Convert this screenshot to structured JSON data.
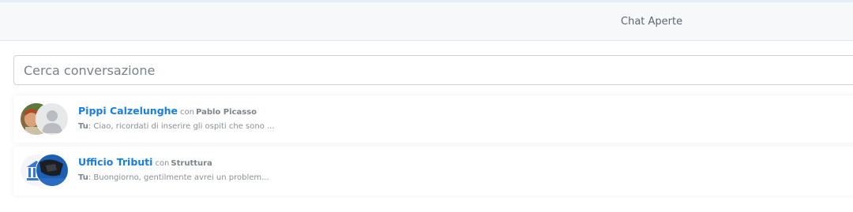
{
  "header": {
    "title": "Chat Aperte"
  },
  "search": {
    "placeholder": "Cerca conversazione"
  },
  "chats": [
    {
      "name": "Pippi Calzelunghe",
      "with_word": "con",
      "with_name": "Pablo Picasso",
      "sender": "Tu",
      "preview": ": Ciao, ricordati di inserire gli ospiti che sono ...",
      "avatars": [
        "portrait-photo",
        "default-user-icon"
      ]
    },
    {
      "name": "Ufficio Tributi",
      "with_word": "con",
      "with_name": "Struttura",
      "sender": "Tu",
      "preview": ": Buongiorno, gentilmente avrei un problem...",
      "avatars": [
        "building-icon",
        "dark-photo"
      ]
    }
  ],
  "colors": {
    "accent": "#1a7de0",
    "header_bg": "#f7f8fa",
    "muted_text": "#8a9097"
  }
}
